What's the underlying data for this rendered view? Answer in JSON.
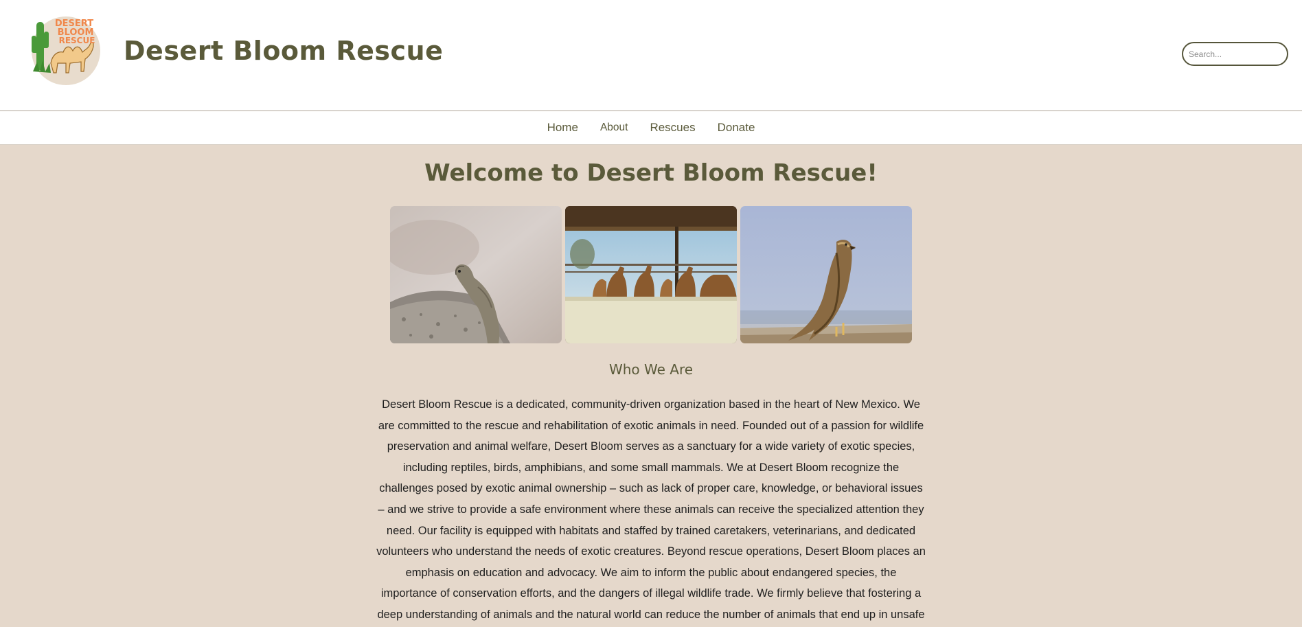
{
  "header": {
    "title": "Desert Bloom Rescue",
    "logo": {
      "text_lines": [
        "DESERT",
        "BLOOM",
        "RESCUE"
      ],
      "icon": "camel-cactus-logo",
      "colors": {
        "text": "#f0874a",
        "circle": "#e8dccd",
        "cactus": "#4a9a3a",
        "camel": "#f2c98a"
      }
    },
    "search": {
      "placeholder": "Search...",
      "value": ""
    }
  },
  "nav": {
    "items": [
      {
        "label": "Home"
      },
      {
        "label": "About"
      },
      {
        "label": "Rescues"
      },
      {
        "label": "Donate"
      }
    ]
  },
  "main": {
    "welcome": "Welcome to Desert Bloom Rescue!",
    "gallery": [
      {
        "subject": "lizard-on-rock-photo"
      },
      {
        "subject": "camels-in-pen-photo"
      },
      {
        "subject": "eagle-on-ground-photo"
      }
    ],
    "who_heading": "Who We Are",
    "about_text": "Desert Bloom Rescue is a dedicated, community-driven organization based in the heart of New Mexico. We are committed to the rescue and rehabilitation of exotic animals in need. Founded out of a passion for wildlife preservation and animal welfare, Desert Bloom serves as a sanctuary for a wide variety of exotic species, including reptiles, birds, amphibians, and some small mammals. We at Desert Bloom recognize the challenges posed by exotic animal ownership – such as lack of proper care, knowledge, or behavioral issues – and we strive to provide a safe environment where these animals can receive the specialized attention they need. Our facility is equipped with habitats and staffed by trained caretakers, veterinarians, and dedicated volunteers who understand the needs of exotic creatures. Beyond rescue operations, Desert Bloom places an emphasis on education and advocacy. We aim to inform the public about endangered species, the importance of conservation efforts, and the dangers of illegal wildlife trade. We firmly believe that fostering a deep understanding of animals and the natural world can reduce the number of animals that end up in unsafe"
  },
  "colors": {
    "accent": "#5a5a3a",
    "page_background": "#e5d8cb",
    "header_background": "#ffffff"
  }
}
